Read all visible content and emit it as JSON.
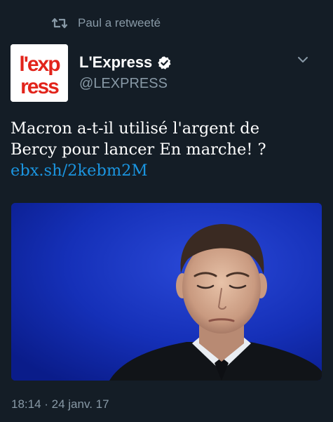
{
  "retweet": {
    "label": "Paul a retweeté",
    "icon": "retweet-icon"
  },
  "tweet": {
    "author": {
      "display_name": "L'Express",
      "handle": "@LEXPRESS",
      "verified": true,
      "avatar_text_top": "l'exp",
      "avatar_text_bottom": "ress",
      "avatar_color": "#e2241b"
    },
    "text_line_1": "Macron a-t-il utilisé l'argent de",
    "text_line_2": "Bercy pour lancer En marche! ?",
    "link": "ebx.sh/2kebm2M",
    "timestamp": "18:14 · 24 janv. 17"
  },
  "colors": {
    "background": "#141d26",
    "muted": "#8899a6",
    "link": "#1b95e0",
    "photo_background": "#0b1f9a"
  }
}
